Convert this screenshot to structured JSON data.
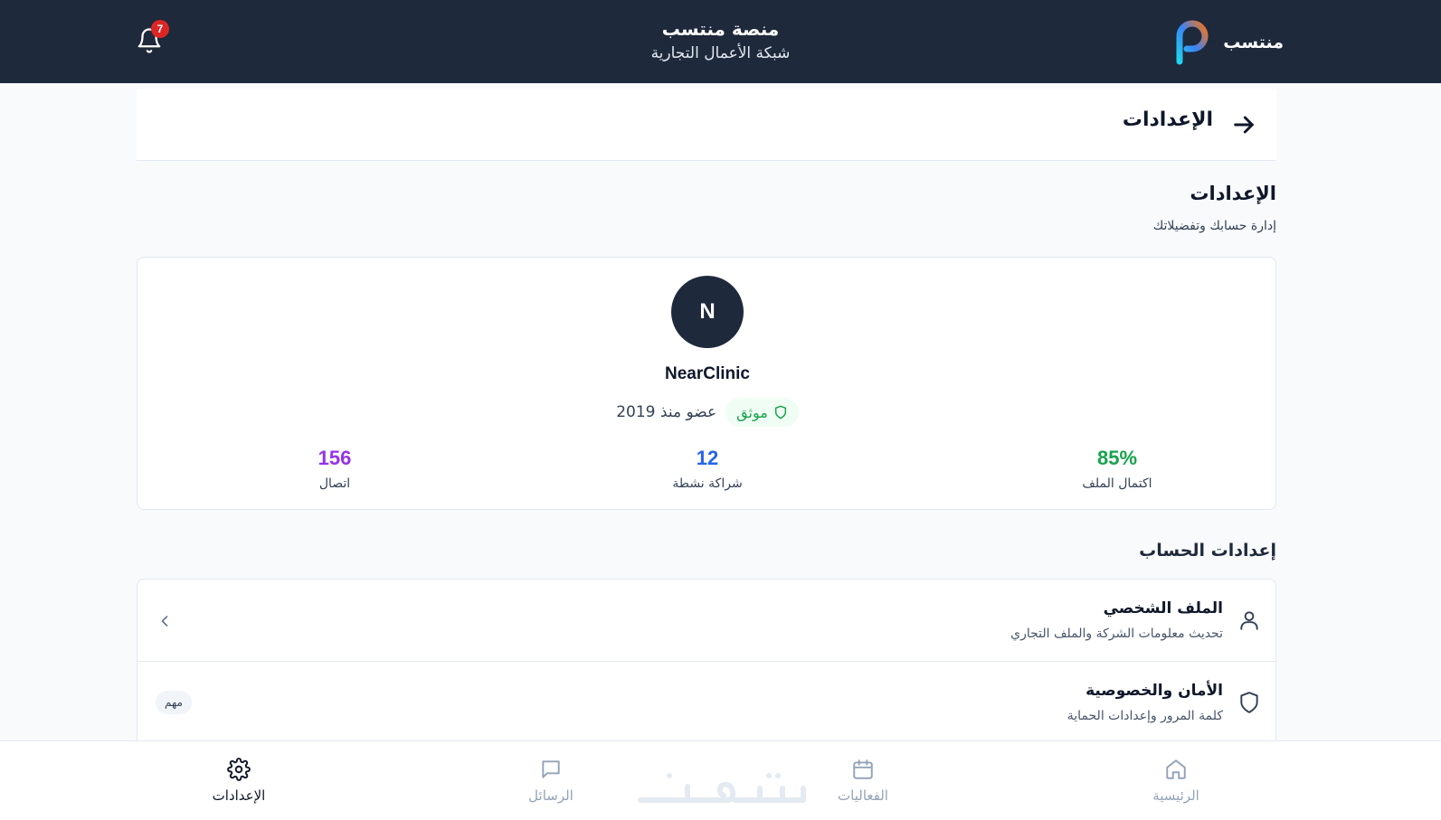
{
  "header": {
    "brand_name": "منتسب",
    "title": "منصة منتسب",
    "subtitle": "شبكة الأعمال التجارية",
    "notification_count": "7"
  },
  "page": {
    "header_title": "الإعدادات",
    "section_title": "الإعدادات",
    "section_subtitle": "إدارة حسابك وتفضيلاتك"
  },
  "profile": {
    "avatar_initial": "N",
    "company_name": "NearClinic",
    "verified_label": "موثق",
    "member_since": "عضو منذ 2019",
    "stats": {
      "completion": {
        "value": "85%",
        "label": "اكتمال الملف"
      },
      "partnerships": {
        "value": "12",
        "label": "شراكة نشطة"
      },
      "connections": {
        "value": "156",
        "label": "اتصال"
      }
    }
  },
  "account_settings": {
    "title": "إعدادات الحساب",
    "items": [
      {
        "title": "الملف الشخصي",
        "description": "تحديث معلومات الشركة والملف التجاري",
        "icon": "user-icon"
      },
      {
        "title": "الأمان والخصوصية",
        "description": "كلمة المرور وإعدادات الحماية",
        "icon": "shield-icon",
        "badge": "مهم"
      }
    ]
  },
  "bottom_nav": {
    "items": [
      {
        "label": "الرئيسية",
        "icon": "home-icon",
        "active": false
      },
      {
        "label": "الفعاليات",
        "icon": "calendar-icon",
        "active": false
      },
      {
        "label": "الرسائل",
        "icon": "message-icon",
        "active": false
      },
      {
        "label": "الإعدادات",
        "icon": "gear-icon",
        "active": true
      }
    ]
  },
  "colors": {
    "header_bg": "#1e293b",
    "completion": "#16a34a",
    "partnerships": "#2563eb",
    "connections": "#9333ea",
    "notification_badge": "#dc2626"
  }
}
